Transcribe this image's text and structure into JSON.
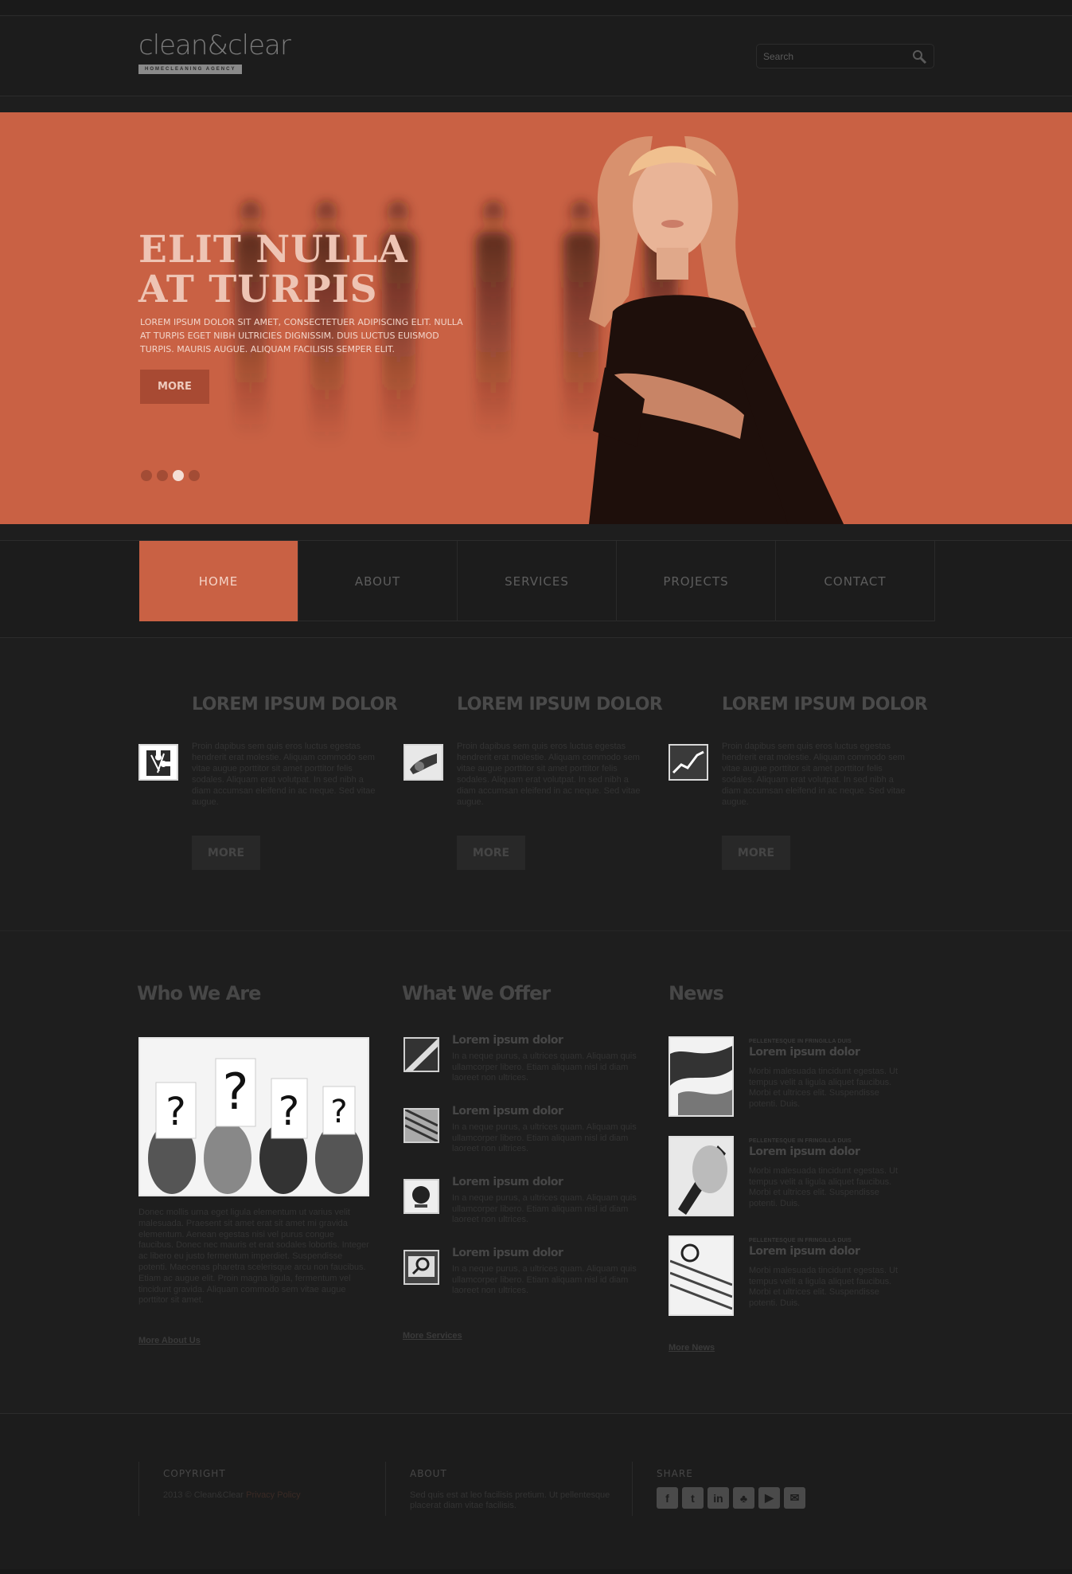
{
  "header": {
    "logo_text": "clean&clear",
    "logo_tagline": "HOMECLEANING AGENCY",
    "search_placeholder": "Search"
  },
  "hero": {
    "title_line1": "ELIT NULLA",
    "title_line2": "AT TURPIS",
    "text": "Lorem ipsum dolor sit amet, consectetuer adipiscing elit. Nulla at turpis eget nibh ultricies dignissim. Duis luctus euismod turpis. Mauris augue. Aliquam facilisis semper elit.",
    "more_label": "MORE",
    "slides": 4,
    "active_slide": 3
  },
  "nav": {
    "items": [
      {
        "label": "HOME"
      },
      {
        "label": "ABOUT"
      },
      {
        "label": "SERVICES"
      },
      {
        "label": "PROJECTS"
      },
      {
        "label": "CONTACT"
      }
    ],
    "active": 0
  },
  "features": [
    {
      "title": "LOREM IPSUM DOLOR",
      "icon": "puzzle-icon",
      "text": "Proin dapibus sem quis eros luctus egestas hendrerit erat molestie. Aliquam commodo sem vitae augue porttitor sit amet porttitor felis sodales. Aliquam erat volutpat. In sed nibh a diam accumsan eleifend in ac neque. Sed vitae augue.",
      "more": "MORE"
    },
    {
      "title": "LOREM IPSUM DOLOR",
      "icon": "handshake-icon",
      "text": "Proin dapibus sem quis eros luctus egestas hendrerit erat molestie. Aliquam commodo sem vitae augue porttitor sit amet porttitor felis sodales. Aliquam erat volutpat. In sed nibh a diam accumsan eleifend in ac neque. Sed vitae augue.",
      "more": "MORE"
    },
    {
      "title": "LOREM IPSUM DOLOR",
      "icon": "chart-icon",
      "text": "Proin dapibus sem quis eros luctus egestas hendrerit erat molestie. Aliquam commodo sem vitae augue porttitor sit amet porttitor felis sodales. Aliquam erat volutpat. In sed nibh a diam accumsan eleifend in ac neque. Sed vitae augue.",
      "more": "MORE"
    }
  ],
  "who": {
    "title": "Who We Are",
    "text": "Donec mollis urna eget ligula elementum ut varius velit malesuada. Praesent sit amet erat sit amet mi gravida elementum. Aenean egestas nisi vel purus congue faucibus. Donec nec mauris et erat sodales lobortis. Integer ac libero eu justo fermentum imperdiet. Suspendisse potenti. Maecenas pharetra scelerisque arcu non faucibus. Etiam ac augue elit. Proin magna ligula, fermentum vel tincidunt gravida. Aliquam commodo sem vitae augue porttitor sit amet.",
    "link": "More About Us"
  },
  "offer": {
    "title": "What We Offer",
    "items": [
      {
        "icon": "light-icon",
        "title": "Lorem ipsum dolor",
        "text": "In a neque purus, a ultrices quam. Aliquam quis ullamcorper libero. Etiam aliquam nisl id diam laoreet non ultrices."
      },
      {
        "icon": "building-icon",
        "title": "Lorem ipsum dolor",
        "text": "In a neque purus, a ultrices quam. Aliquam quis ullamcorper libero. Etiam aliquam nisl id diam laoreet non ultrices."
      },
      {
        "icon": "globe-icon",
        "title": "Lorem ipsum dolor",
        "text": "In a neque purus, a ultrices quam. Aliquam quis ullamcorper libero. Etiam aliquam nisl id diam laoreet non ultrices."
      },
      {
        "icon": "magnifier-icon",
        "title": "Lorem ipsum dolor",
        "text": "In a neque purus, a ultrices quam. Aliquam quis ullamcorper libero. Etiam aliquam nisl id diam laoreet non ultrices."
      }
    ],
    "link": "More Services"
  },
  "news": {
    "title": "News",
    "items": [
      {
        "kicker": "PELLENTESQUE IN FRINGILLA DUIS",
        "title": "Lorem ipsum dolor",
        "text": "Morbi malesuada tincidunt egestas. Ut tempus velit a ligula aliquet faucibus. Morbi et ultrices elit. Suspendisse potenti. Duis."
      },
      {
        "kicker": "PELLENTESQUE IN FRINGILLA DUIS",
        "title": "Lorem ipsum dolor",
        "text": "Morbi malesuada tincidunt egestas. Ut tempus velit a ligula aliquet faucibus. Morbi et ultrices elit. Suspendisse potenti. Duis."
      },
      {
        "kicker": "PELLENTESQUE IN FRINGILLA DUIS",
        "title": "Lorem ipsum dolor",
        "text": "Morbi malesuada tincidunt egestas. Ut tempus velit a ligula aliquet faucibus. Morbi et ultrices elit. Suspendisse potenti. Duis."
      }
    ],
    "link": "More News"
  },
  "footer": {
    "copyright_head": "COPYRIGHT",
    "copyright_text": "2013 © Clean&Clear",
    "privacy_link": "Privacy Policy",
    "about_head": "ABOUT",
    "about_text": "Sed quis est at leo facilisis pretium. Ut pellentesque placerat diam vitae facilisis.",
    "share_head": "SHARE",
    "social": [
      {
        "icon": "facebook-icon",
        "glyph": "f"
      },
      {
        "icon": "twitter-icon",
        "glyph": "t"
      },
      {
        "icon": "linkedin-icon",
        "glyph": "in"
      },
      {
        "icon": "myspace-icon",
        "glyph": "♣"
      },
      {
        "icon": "youtube-icon",
        "glyph": "▶"
      },
      {
        "icon": "chat-icon",
        "glyph": "✉"
      }
    ]
  },
  "colors": {
    "accent": "#c96144",
    "background": "#1e1e1e",
    "header": "#1c1c1c"
  }
}
